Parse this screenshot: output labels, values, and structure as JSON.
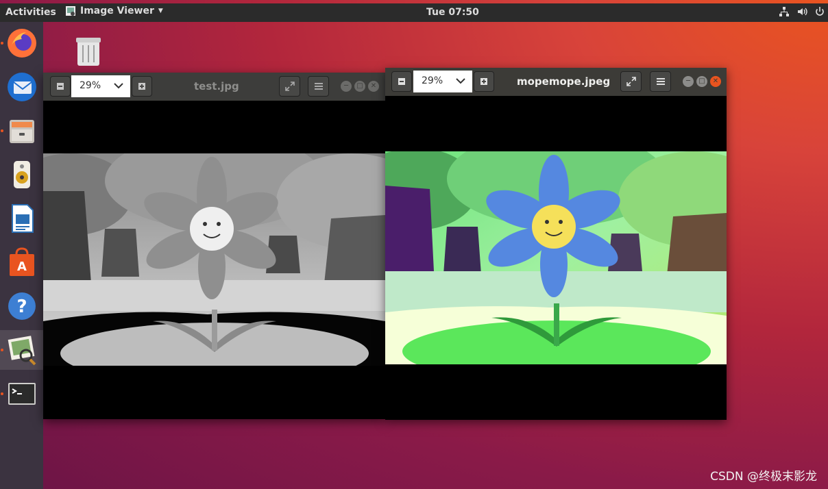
{
  "topbar": {
    "activities": "Activities",
    "app_menu": "Image Viewer",
    "clock": "Tue 07:50"
  },
  "dock": {
    "items": [
      "firefox-icon",
      "thunderbird-icon",
      "files-icon",
      "rhythmbox-icon",
      "writer-icon",
      "software-icon",
      "help-icon",
      "image-viewer-icon",
      "terminal-icon"
    ]
  },
  "windows": {
    "left": {
      "title": "test.jpg",
      "zoom": "29%",
      "style": "grayscale"
    },
    "right": {
      "title": "mopemope.jpeg",
      "zoom": "29%",
      "style": "color"
    }
  },
  "watermark": "CSDN @终极末影龙",
  "colors": {
    "accent": "#e95420",
    "panel": "#2b2b2b",
    "dock": "#3b3340",
    "titlebar": "#3d3d3b",
    "close": "#e9541f"
  }
}
